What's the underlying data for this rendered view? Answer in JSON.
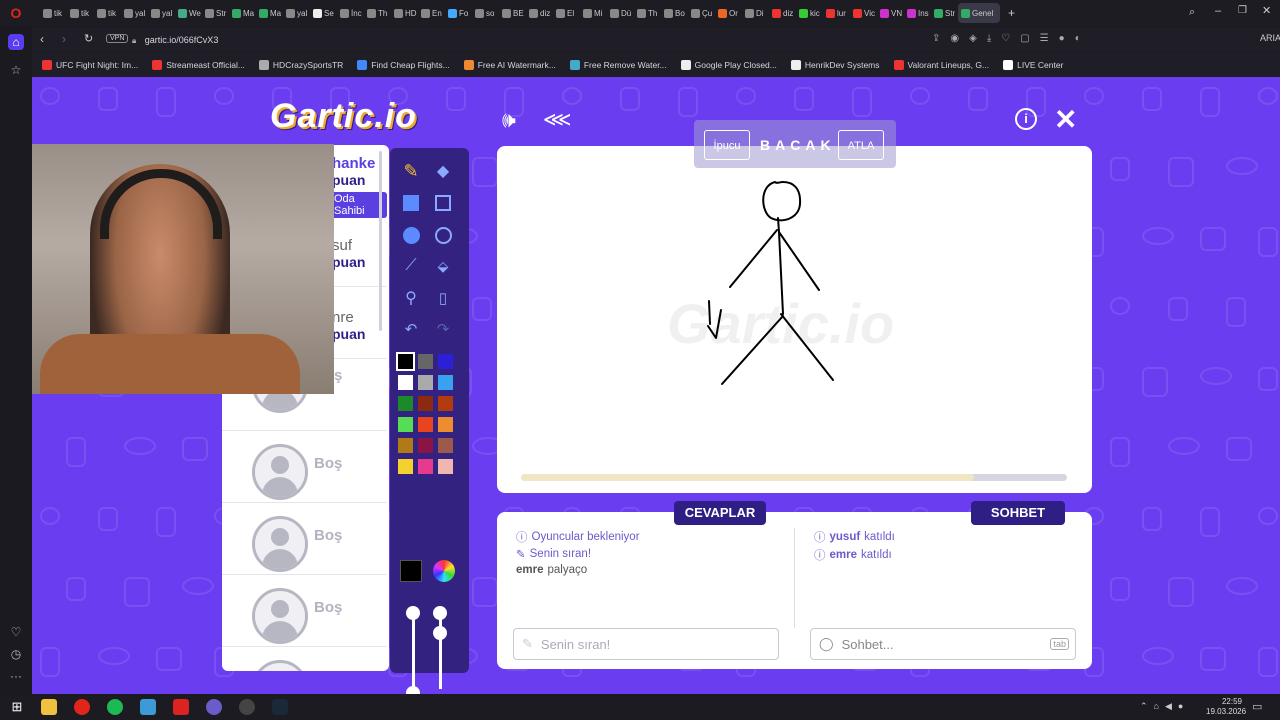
{
  "browser": {
    "tabs": [
      "tik",
      "tik",
      "tik",
      "yal",
      "yal",
      "We",
      "Str",
      "Ma",
      "Ma",
      "yal",
      "Se",
      "İnc",
      "Th",
      "HD",
      "En",
      "Fo",
      "so",
      "BE",
      "diz",
      "El",
      "Mi",
      "Dü",
      "Th",
      "Bo",
      "Çu",
      "Or",
      "Di",
      "diz",
      "kic",
      "lur",
      "Vic",
      "VN",
      "Ins",
      "Str",
      "Genel"
    ],
    "url": "gartic.io/066fCvX3",
    "vpn_label": "VPN",
    "aria_label": "ARIA",
    "bookmarks": [
      "UFC Fight Night: Im...",
      "Streameast Official...",
      "HDCrazySportsTR",
      "Find Cheap Flights...",
      "Free AI Watermark...",
      "Free Remove Water...",
      "Google Play Closed...",
      "HenrikDev Systems",
      "Valorant Lineups, G...",
      "LIVE Center"
    ]
  },
  "game": {
    "logo": "Gartic.io",
    "word_hint": "İpucu",
    "word": "BACAK",
    "skip": "ATLA",
    "players": [
      {
        "name": "hanke",
        "points": "puan",
        "badge": "Oda Sahibi"
      },
      {
        "name": "suf",
        "points": "puan"
      },
      {
        "name": "nre",
        "points": "puan"
      }
    ],
    "empty_slot": "Boş",
    "answers_tab": "CEVAPLAR",
    "chat_tab": "SOHBET",
    "answers_messages": [
      {
        "icon": "info",
        "text": "Oyuncular bekleniyor"
      },
      {
        "icon": "pencil",
        "text": "Senin sıran!"
      },
      {
        "user": "emre",
        "text": "palyaço"
      }
    ],
    "chat_messages": [
      {
        "user": "yusuf",
        "text": "katıldı"
      },
      {
        "user": "emre",
        "text": "katıldı"
      }
    ],
    "answer_placeholder": "Senin sıran!",
    "chat_placeholder": "Sohbet...",
    "chat_key": "tab",
    "progress": 0.83,
    "colors": [
      "#000000",
      "#666666",
      "#2c1fd8",
      "#ffffff",
      "#aaaaaa",
      "#3aa0f0",
      "#1a8a2a",
      "#8b2a10",
      "#b23b10",
      "#55dd55",
      "#e8451f",
      "#ef8c2f",
      "#b07a1a",
      "#8a1446",
      "#9b5a4a",
      "#f5d130",
      "#e83a8c",
      "#f0b6b0"
    ]
  },
  "taskbar": {
    "time": "22:59",
    "date": "19.03.2026"
  }
}
